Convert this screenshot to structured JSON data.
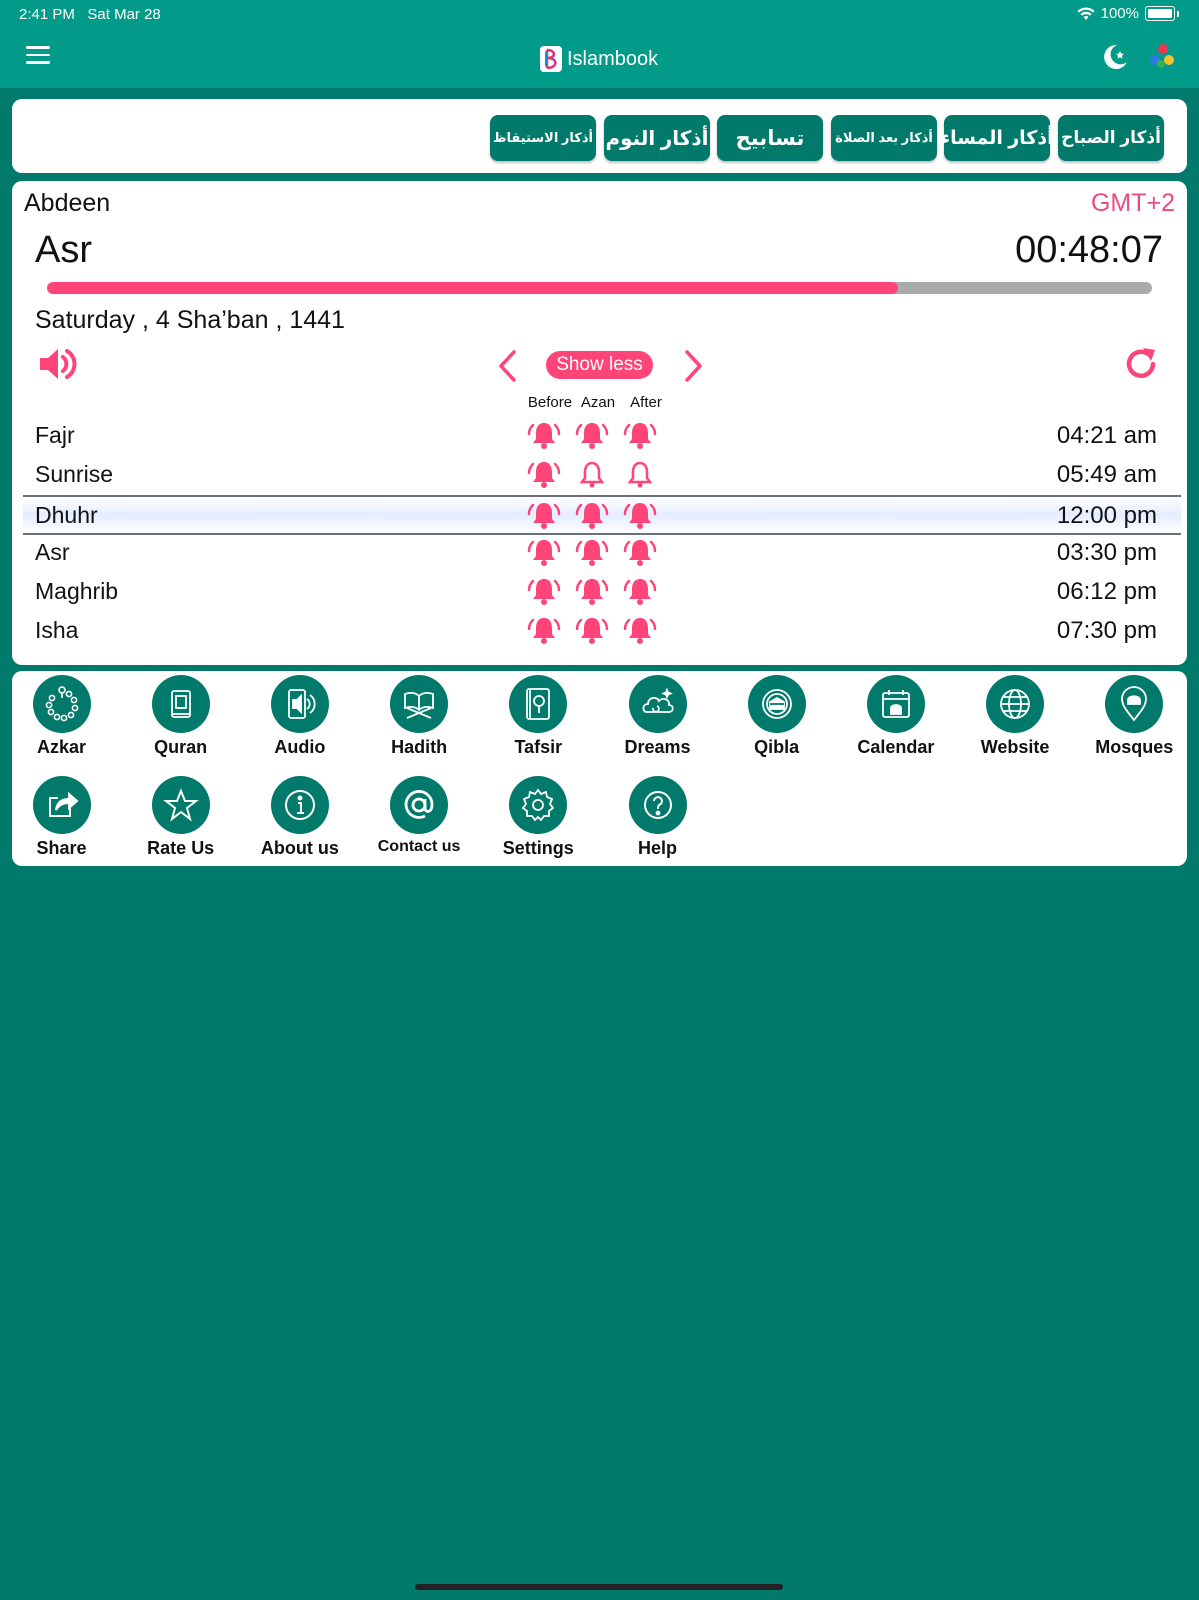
{
  "status_bar": {
    "time": "2:41 PM",
    "date": "Sat Mar 28",
    "battery": "100%"
  },
  "nav": {
    "brand": "Islambook"
  },
  "azkar_buttons": [
    "أذكار الصباح",
    "أذكار المساء",
    "أذكار بعد الصلاة",
    "تسابيح",
    "أذكار النوم",
    "أذكار الاستيقاظ"
  ],
  "prayer": {
    "city": "Abdeen",
    "timezone": "GMT+2",
    "current_prayer": "Asr",
    "countdown": "00:48:07",
    "progress": 0.77,
    "hijri_date": "Saturday , 4 Sha’ban , 1441",
    "show_less": "Show less",
    "columns": [
      "Before",
      "Azan",
      "After"
    ],
    "times": [
      {
        "name": "Fajr",
        "time": "04:21 am",
        "alerts": [
          true,
          true,
          true
        ]
      },
      {
        "name": "Sunrise",
        "time": "05:49 am",
        "alerts": [
          true,
          false,
          false
        ]
      },
      {
        "name": "Dhuhr",
        "time": "12:00 pm",
        "alerts": [
          true,
          true,
          true
        ]
      },
      {
        "name": "Asr",
        "time": "03:30 pm",
        "alerts": [
          true,
          true,
          true
        ]
      },
      {
        "name": "Maghrib",
        "time": "06:12 pm",
        "alerts": [
          true,
          true,
          true
        ]
      },
      {
        "name": "Isha",
        "time": "07:30 pm",
        "alerts": [
          true,
          true,
          true
        ]
      }
    ]
  },
  "menu": [
    {
      "label": "Azkar",
      "icon": "prayer-beads-icon"
    },
    {
      "label": "Quran",
      "icon": "quran-book-icon"
    },
    {
      "label": "Audio",
      "icon": "audio-speaker-icon"
    },
    {
      "label": "Hadith",
      "icon": "open-book-stand-icon"
    },
    {
      "label": "Tafsir",
      "icon": "book-search-icon"
    },
    {
      "label": "Dreams",
      "icon": "dream-cloud-icon"
    },
    {
      "label": "Qibla",
      "icon": "kaaba-compass-icon"
    },
    {
      "label": "Calendar",
      "icon": "calendar-mosque-icon"
    },
    {
      "label": "Website",
      "icon": "globe-icon"
    },
    {
      "label": "Mosques",
      "icon": "mosque-pin-icon"
    },
    {
      "label": "Share",
      "icon": "share-icon"
    },
    {
      "label": "Rate Us",
      "icon": "star-icon"
    },
    {
      "label": "About us",
      "icon": "info-icon"
    },
    {
      "label": "Contact us",
      "icon": "at-sign-icon"
    },
    {
      "label": "Settings",
      "icon": "gear-icon"
    },
    {
      "label": "Help",
      "icon": "help-icon"
    }
  ],
  "colors": {
    "teal": "#017a6c",
    "teal_light": "#029a88",
    "pink": "#ff4479",
    "accent_text": "#e94c83"
  }
}
